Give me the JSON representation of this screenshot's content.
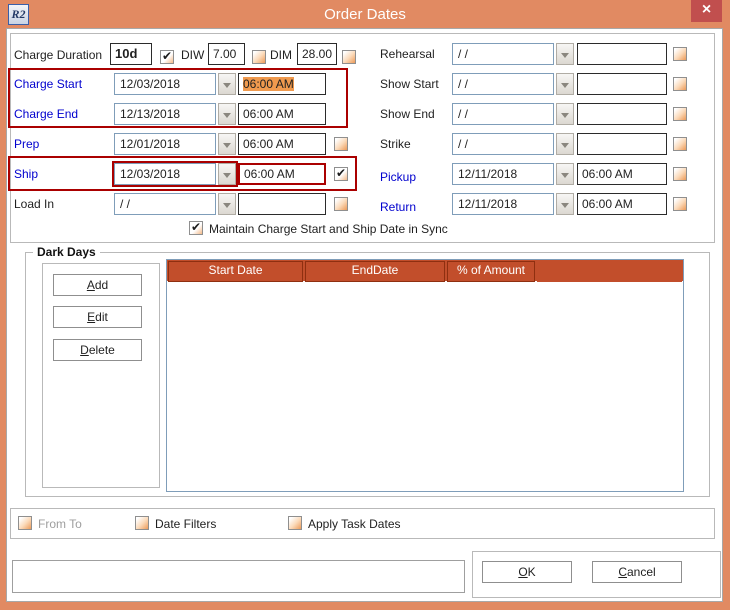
{
  "window": {
    "title": "Order Dates",
    "icon_text": "R2",
    "close_glyph": "×"
  },
  "colors": {
    "frame": "#E18A62",
    "close_button": "#C14F4E",
    "table_header": "#C24E2B",
    "annotation_red": "#AA0000",
    "label_blue": "#0000CE",
    "time_selection": "#F09A4E"
  },
  "duration_row": {
    "label": "Charge Duration",
    "value": "10d",
    "checked": true,
    "diw_label": "DIW",
    "diw_value": "7.00",
    "diw_checked": false,
    "dim_label": "DIM",
    "dim_value": "28.00",
    "dim_checked": false
  },
  "left_rows": [
    {
      "label": "Charge Start",
      "date": "12/03/2018",
      "time": "06:00 AM"
    },
    {
      "label": "Charge End",
      "date": "12/13/2018",
      "time": "06:00 AM"
    },
    {
      "label": "Prep",
      "date": "12/01/2018",
      "time": "06:00 AM",
      "checked": false
    },
    {
      "label": "Ship",
      "date": "12/03/2018",
      "time": "06:00 AM",
      "checked": true
    },
    {
      "label": "Load In",
      "date": "/ /",
      "time": "",
      "checked": false
    }
  ],
  "right_rows": [
    {
      "label": "Rehearsal",
      "date": "/ /",
      "time": "",
      "checked": false
    },
    {
      "label": "Show Start",
      "date": "/ /",
      "time": "",
      "checked": false
    },
    {
      "label": "Show End",
      "date": "/ /",
      "time": "",
      "checked": false
    },
    {
      "label": "Strike",
      "date": "/ /",
      "time": "",
      "checked": false
    },
    {
      "label": "Pickup",
      "date": "12/11/2018",
      "time": "06:00 AM",
      "checked": false
    },
    {
      "label": "Return",
      "date": "12/11/2018",
      "time": "06:00 AM",
      "checked": false
    }
  ],
  "sync_row": {
    "label": "Maintain Charge Start and Ship Date in Sync",
    "checked": true
  },
  "dark_days": {
    "title": "Dark Days",
    "add_label": "Add",
    "edit_label": "Edit",
    "delete_label": "Delete",
    "table": {
      "columns": [
        "Start Date",
        "EndDate",
        "% of Amount"
      ],
      "rows": []
    }
  },
  "footer_options": [
    {
      "label": "From To",
      "checked": false,
      "disabled": true
    },
    {
      "label": "Date Filters",
      "checked": false,
      "disabled": false
    },
    {
      "label": "Apply Task Dates",
      "checked": false,
      "disabled": false
    }
  ],
  "bottom_bar": {
    "note_value": "",
    "ok_label": "OK",
    "cancel_label": "Cancel"
  }
}
